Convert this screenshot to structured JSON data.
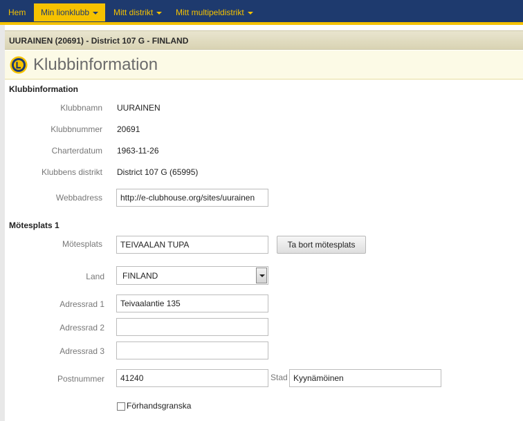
{
  "nav": {
    "home": "Hem",
    "my_club": "Min lionklubb",
    "my_district": "Mitt distrikt",
    "my_multiple_district": "Mitt multipeldistrikt"
  },
  "club_header": "UURAINEN (20691) - District 107 G - FINLAND",
  "page_title": "Klubbinformation",
  "club_info": {
    "section_title": "Klubbinformation",
    "name_label": "Klubbnamn",
    "name_value": "UURAINEN",
    "number_label": "Klubbnummer",
    "number_value": "20691",
    "charter_label": "Charterdatum",
    "charter_value": "1963-11-26",
    "district_label": "Klubbens distrikt",
    "district_value": "District 107 G (65995)",
    "web_label": "Webbadress",
    "web_value": "http://e-clubhouse.org/sites/uurainen"
  },
  "meeting": {
    "section_title": "Mötesplats 1",
    "place_label": "Mötesplats",
    "place_value": "TEIVAALAN TUPA",
    "remove_button": "Ta bort mötesplats",
    "country_label": "Land",
    "country_value": "FINLAND",
    "address1_label": "Adressrad 1",
    "address1_value": "Teivaalantie 135",
    "address2_label": "Adressrad 2",
    "address2_value": "",
    "address3_label": "Adressrad 3",
    "address3_value": "",
    "postal_label": "Postnummer",
    "postal_value": "41240",
    "city_label": "Stad",
    "city_value": "Kyynämöinen",
    "preview_label": "Förhandsgranska"
  },
  "colors": {
    "nav_bg": "#1e3a6e",
    "nav_accent": "#f5c200",
    "title_bg": "#fcfae6"
  }
}
